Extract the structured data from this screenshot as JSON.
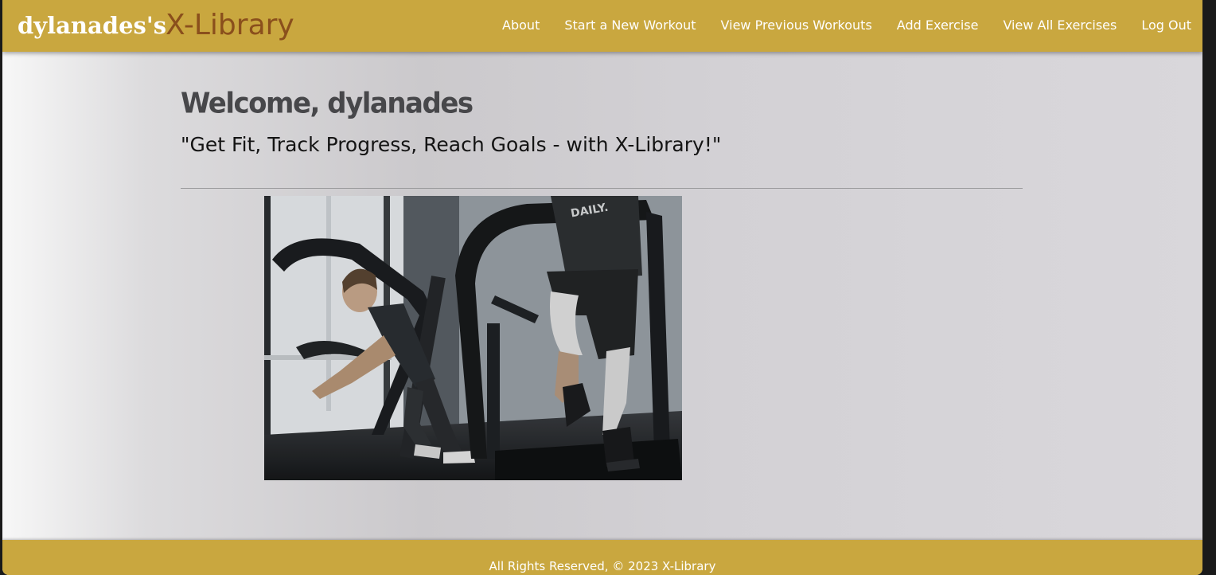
{
  "header": {
    "username_title": "dylanades's",
    "brand": "X-Library",
    "nav": [
      {
        "label": "About"
      },
      {
        "label": "Start a New Workout"
      },
      {
        "label": "View Previous Workouts"
      },
      {
        "label": "Add Exercise"
      },
      {
        "label": "View All Exercises"
      },
      {
        "label": "Log Out"
      }
    ]
  },
  "main": {
    "welcome": "Welcome, dylanades",
    "tagline": "\"Get Fit, Track Progress, Reach Goals - with X-Library!\"",
    "hero_image": {
      "icon": "gym-treadmill-photo"
    }
  },
  "footer": {
    "text": "All Rights Reserved, © 2023 X-Library"
  },
  "colors": {
    "header_bg": "#c9a73f",
    "brand_text": "#8a4f1c",
    "page_bg": "#d3d1d5"
  }
}
